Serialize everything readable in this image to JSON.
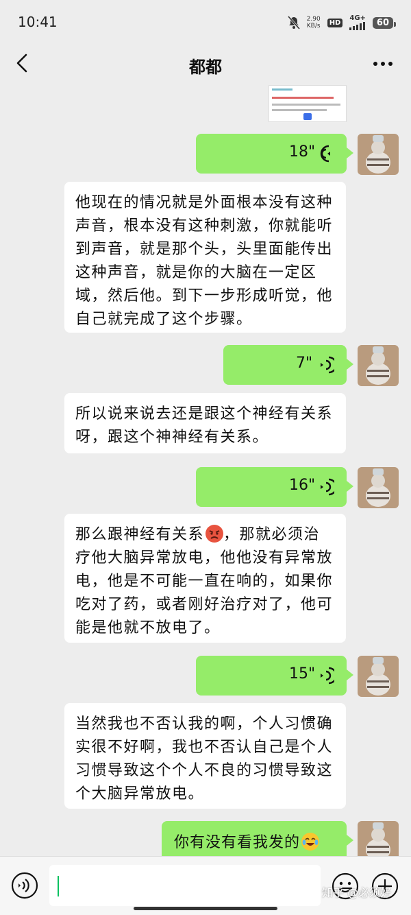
{
  "status_bar": {
    "time": "10:41",
    "speed_value": "2.90",
    "speed_unit": "KB/s",
    "hd": "HD",
    "network": "4G+",
    "battery": "60"
  },
  "nav": {
    "title": "都都"
  },
  "messages": [
    {
      "type": "voice_out",
      "duration": "18\""
    },
    {
      "type": "text_in",
      "text": "他现在的情况就是外面根本没有这种声音，根本没有这种刺激，你就能听到声音，就是那个头，头里面能传出这种声音，就是你的大脑在一定区域，然后他。到下一步形成听觉，他自己就完成了这个步骤。"
    },
    {
      "type": "voice_out",
      "duration": "7\""
    },
    {
      "type": "text_in",
      "text": "所以说来说去还是跟这个神经有关系呀，跟这个神神经有关系。"
    },
    {
      "type": "voice_out",
      "duration": "16\""
    },
    {
      "type": "text_in",
      "text_before_emoji": "那么跟神经有关系",
      "emoji": "angry-face-emoji",
      "text_after_emoji": "，那就必须治疗他大脑异常放电，他他没有异常放电，他是不可能一直在响的，如果你吃对了药，或者刚好治疗对了，他可能是他就不放电了。"
    },
    {
      "type": "voice_out",
      "duration": "15\""
    },
    {
      "type": "text_in",
      "text": "当然我也不否认我的啊，个人习惯确实很不好啊，我也不否认自己是个人习惯导致这个个人不良的习惯导致这个大脑异常放电。"
    },
    {
      "type": "text_out",
      "text": "你有没有看我发的",
      "emoji": "laughing-tears-emoji"
    }
  ],
  "watermark": "知乎 @必须好",
  "colors": {
    "background": "#ededed",
    "bubble_out": "#95ec69",
    "bubble_in": "#ffffff",
    "accent": "#07c160"
  }
}
